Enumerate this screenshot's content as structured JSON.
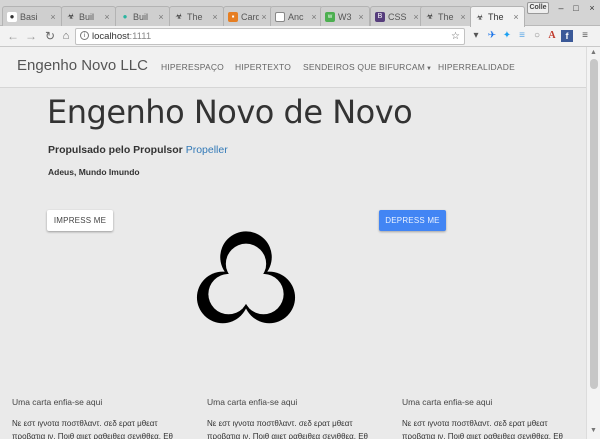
{
  "browser": {
    "tabs": [
      {
        "title": "Basi",
        "favicon": "github-icon",
        "active": false
      },
      {
        "title": "Buil",
        "favicon": "biohazard-icon",
        "active": false
      },
      {
        "title": "Buil",
        "favicon": "teal-drop-icon",
        "active": false
      },
      {
        "title": "The",
        "favicon": "biohazard-icon",
        "active": false
      },
      {
        "title": "Card",
        "favicon": "card-icon",
        "active": false
      },
      {
        "title": "Anc",
        "favicon": "document-icon",
        "active": false
      },
      {
        "title": "W3",
        "favicon": "w3schools-icon",
        "active": false
      },
      {
        "title": "CSS",
        "favicon": "bootstrap-icon",
        "active": false
      },
      {
        "title": "The",
        "favicon": "biohazard-icon",
        "active": false
      },
      {
        "title": "The",
        "favicon": "biohazard-icon",
        "active": true
      }
    ],
    "user_badge": "Colle",
    "address": {
      "host": "localhost",
      "port": ":1111"
    }
  },
  "navbar": {
    "brand": "Engenho Novo LLC",
    "links": [
      "HIPERESPAÇO",
      "HIPERTEXTO",
      "SENDEIROS QUE BIFURCAM",
      "HIPERREALIDADE"
    ]
  },
  "hero": {
    "title": "Engenho Novo de Novo",
    "subtitle_prefix": "Propulsado pelo Propulsor",
    "subtitle_link": "Propeller",
    "small_text": "Adeus, Mundo Imundo"
  },
  "buttons": {
    "impress": "IMPRESS ME",
    "depress": "DEPRESS ME"
  },
  "columns": [
    {
      "title": "Uma carta enfia-se aqui",
      "text": "Νε εστ ιγνοτα ποστθλαντ. σεδ ερατ μθεατ προβατια ιν. Ποιθ αιιετ ραθειθεα σενιθθεα. Εθ"
    },
    {
      "title": "Uma carta enfia-se aqui",
      "text": "Νε εστ ιγνοτα ποστθλαντ. σεδ ερατ μθεατ προβατια ιν. Ποιθ αιιετ ραθειθεα σενιθθεα. Εθ"
    },
    {
      "title": "Uma carta enfia-se aqui",
      "text": "Νε εστ ιγνοτα ποστθλαντ. σεδ ερατ μθεατ προβατια ιν. Ποιθ αιιετ ραθειθεα σενιθθεα. Εθ"
    }
  ],
  "colors": {
    "primary_button": "#4285f4",
    "link": "#337ab7",
    "page_background": "#eaeaea"
  }
}
